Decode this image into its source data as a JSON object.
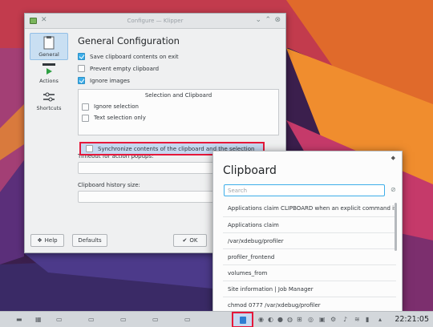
{
  "config_window": {
    "title": "Configure — Klipper",
    "sidebar": [
      {
        "label": "General",
        "icon": "general-settings-icon",
        "active": true
      },
      {
        "label": "Actions",
        "icon": "actions-icon",
        "active": false
      },
      {
        "label": "Shortcuts",
        "icon": "shortcuts-icon",
        "active": false
      }
    ],
    "heading": "General Configuration",
    "options": [
      {
        "label": "Save clipboard contents on exit",
        "checked": true
      },
      {
        "label": "Prevent empty clipboard",
        "checked": false
      },
      {
        "label": "Ignore images",
        "checked": true
      }
    ],
    "group": {
      "title": "Selection and Clipboard",
      "options": [
        {
          "label": "Ignore selection",
          "checked": false
        },
        {
          "label": "Text selection only",
          "checked": false
        },
        {
          "label": "Synchronize contents of the clipboard and the selection",
          "checked": false
        }
      ]
    },
    "timeout_label": "Timeout for action popups:",
    "history_label": "Clipboard history size:",
    "buttons": {
      "help": "Help",
      "defaults": "Defaults",
      "ok": "OK"
    }
  },
  "clipboard_popup": {
    "title": "Clipboard",
    "search_placeholder": "Search",
    "items": [
      "Applications claim CLIPBOARD when an explicit command is giv...",
      "Applications claim",
      "/var/xdebug/profiler",
      "profiler_frontend",
      "volumes_from",
      "Site information | Job Manager",
      "chmod 0777 /var/xdebug/profiler"
    ]
  },
  "taskbar": {
    "clock": "22:21:05"
  },
  "colors": {
    "accent": "#3daee9",
    "highlight_border": "#e5183a",
    "window_bg": "#eff0f1"
  }
}
